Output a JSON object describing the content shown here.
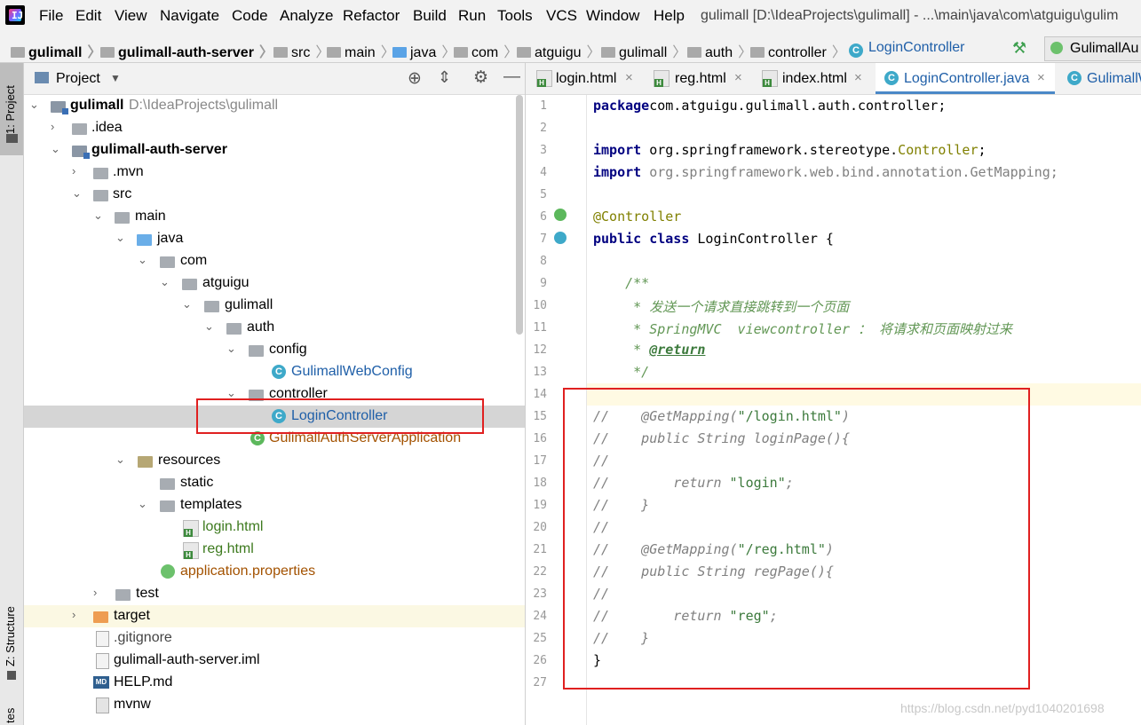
{
  "menu": {
    "items": [
      "File",
      "Edit",
      "View",
      "Navigate",
      "Code",
      "Analyze",
      "Refactor",
      "Build",
      "Run",
      "Tools",
      "VCS",
      "Window",
      "Help"
    ],
    "title": "gulimall [D:\\IdeaProjects\\gulimall] - ...\\main\\java\\com\\atguigu\\gulim"
  },
  "breadcrumbs": [
    "gulimall",
    "gulimall-auth-server",
    "src",
    "main",
    "java",
    "com",
    "atguigu",
    "gulimall",
    "auth",
    "controller",
    "LoginController"
  ],
  "run_config": "GulimallAu",
  "sidebar": {
    "project_tab": "1: Project",
    "structure_tab": "Z: Structure",
    "favorites_tab": "tes"
  },
  "project": {
    "header": "Project",
    "tree": [
      {
        "label": "gulimall",
        "hint": "D:\\IdeaProjects\\gulimall",
        "bold": true
      },
      {
        "label": ".idea"
      },
      {
        "label": "gulimall-auth-server",
        "bold": true
      },
      {
        "label": ".mvn"
      },
      {
        "label": "src"
      },
      {
        "label": "main"
      },
      {
        "label": "java"
      },
      {
        "label": "com"
      },
      {
        "label": "atguigu"
      },
      {
        "label": "gulimall"
      },
      {
        "label": "auth"
      },
      {
        "label": "config"
      },
      {
        "label": "GulimallWebConfig"
      },
      {
        "label": "controller"
      },
      {
        "label": "LoginController"
      },
      {
        "label": "GulimallAuthServerApplication"
      },
      {
        "label": "resources"
      },
      {
        "label": "static"
      },
      {
        "label": "templates"
      },
      {
        "label": "login.html"
      },
      {
        "label": "reg.html"
      },
      {
        "label": "application.properties"
      },
      {
        "label": "test"
      },
      {
        "label": "target"
      },
      {
        "label": ".gitignore"
      },
      {
        "label": "gulimall-auth-server.iml"
      },
      {
        "label": "HELP.md"
      },
      {
        "label": "mvnw"
      }
    ]
  },
  "editor": {
    "tabs": [
      "login.html",
      "reg.html",
      "index.html",
      "LoginController.java",
      "GulimallW"
    ],
    "active_tab": "LoginController.java",
    "lines": [
      {
        "n": "1",
        "p": [
          [
            "kw",
            "package"
          ],
          [
            "",
            "com.atguigu.gulimall.auth.controller;"
          ]
        ]
      },
      {
        "n": "2",
        "p": []
      },
      {
        "n": "3",
        "p": [
          [
            "kw",
            "import"
          ],
          [
            "",
            " org.springframework.stereotype."
          ],
          [
            "cls",
            "Controller"
          ],
          [
            "",
            ";"
          ]
        ]
      },
      {
        "n": "4",
        "p": [
          [
            "kw",
            "import"
          ],
          [
            "gray",
            " org.springframework.web.bind.annotation.GetMapping;"
          ]
        ]
      },
      {
        "n": "5",
        "p": []
      },
      {
        "n": "6",
        "p": [
          [
            "ann",
            "@Controller"
          ]
        ]
      },
      {
        "n": "7",
        "p": [
          [
            "kw",
            "public class"
          ],
          [
            "",
            " LoginController {"
          ]
        ]
      },
      {
        "n": "8",
        "p": []
      },
      {
        "n": "9",
        "p": [
          [
            "doc",
            "    /**"
          ]
        ]
      },
      {
        "n": "10",
        "p": [
          [
            "doc",
            "     * 发送一个请求直接跳转到一个页面"
          ]
        ]
      },
      {
        "n": "11",
        "p": [
          [
            "doc",
            "     * SpringMVC  viewcontroller ： 将请求和页面映射过来"
          ]
        ]
      },
      {
        "n": "12",
        "p": [
          [
            "doc",
            "     * "
          ],
          [
            "doc-b",
            "@return"
          ]
        ]
      },
      {
        "n": "13",
        "p": [
          [
            "doc",
            "     */"
          ]
        ]
      },
      {
        "n": "14",
        "p": []
      },
      {
        "n": "15",
        "p": [
          [
            "cm",
            "//    @GetMapping("
          ],
          [
            "cm-str",
            "\"/login.html\""
          ],
          [
            "cm",
            ")"
          ]
        ]
      },
      {
        "n": "16",
        "p": [
          [
            "cm",
            "//    public String loginPage(){"
          ]
        ]
      },
      {
        "n": "17",
        "p": [
          [
            "cm",
            "//"
          ]
        ]
      },
      {
        "n": "18",
        "p": [
          [
            "cm",
            "//        return "
          ],
          [
            "cm-str",
            "\"login\""
          ],
          [
            "cm",
            ";"
          ]
        ]
      },
      {
        "n": "19",
        "p": [
          [
            "cm",
            "//    }"
          ]
        ]
      },
      {
        "n": "20",
        "p": [
          [
            "cm",
            "//"
          ]
        ]
      },
      {
        "n": "21",
        "p": [
          [
            "cm",
            "//    @GetMapping("
          ],
          [
            "cm-str",
            "\"/reg.html\""
          ],
          [
            "cm",
            ")"
          ]
        ]
      },
      {
        "n": "22",
        "p": [
          [
            "cm",
            "//    public String regPage(){"
          ]
        ]
      },
      {
        "n": "23",
        "p": [
          [
            "cm",
            "//"
          ]
        ]
      },
      {
        "n": "24",
        "p": [
          [
            "cm",
            "//        return "
          ],
          [
            "cm-str",
            "\"reg\""
          ],
          [
            "cm",
            ";"
          ]
        ]
      },
      {
        "n": "25",
        "p": [
          [
            "cm",
            "//    }"
          ]
        ]
      },
      {
        "n": "26",
        "p": [
          [
            "",
            "}"
          ]
        ]
      },
      {
        "n": "27",
        "p": []
      }
    ]
  },
  "watermark": "https://blog.csdn.net/pyd1040201698"
}
